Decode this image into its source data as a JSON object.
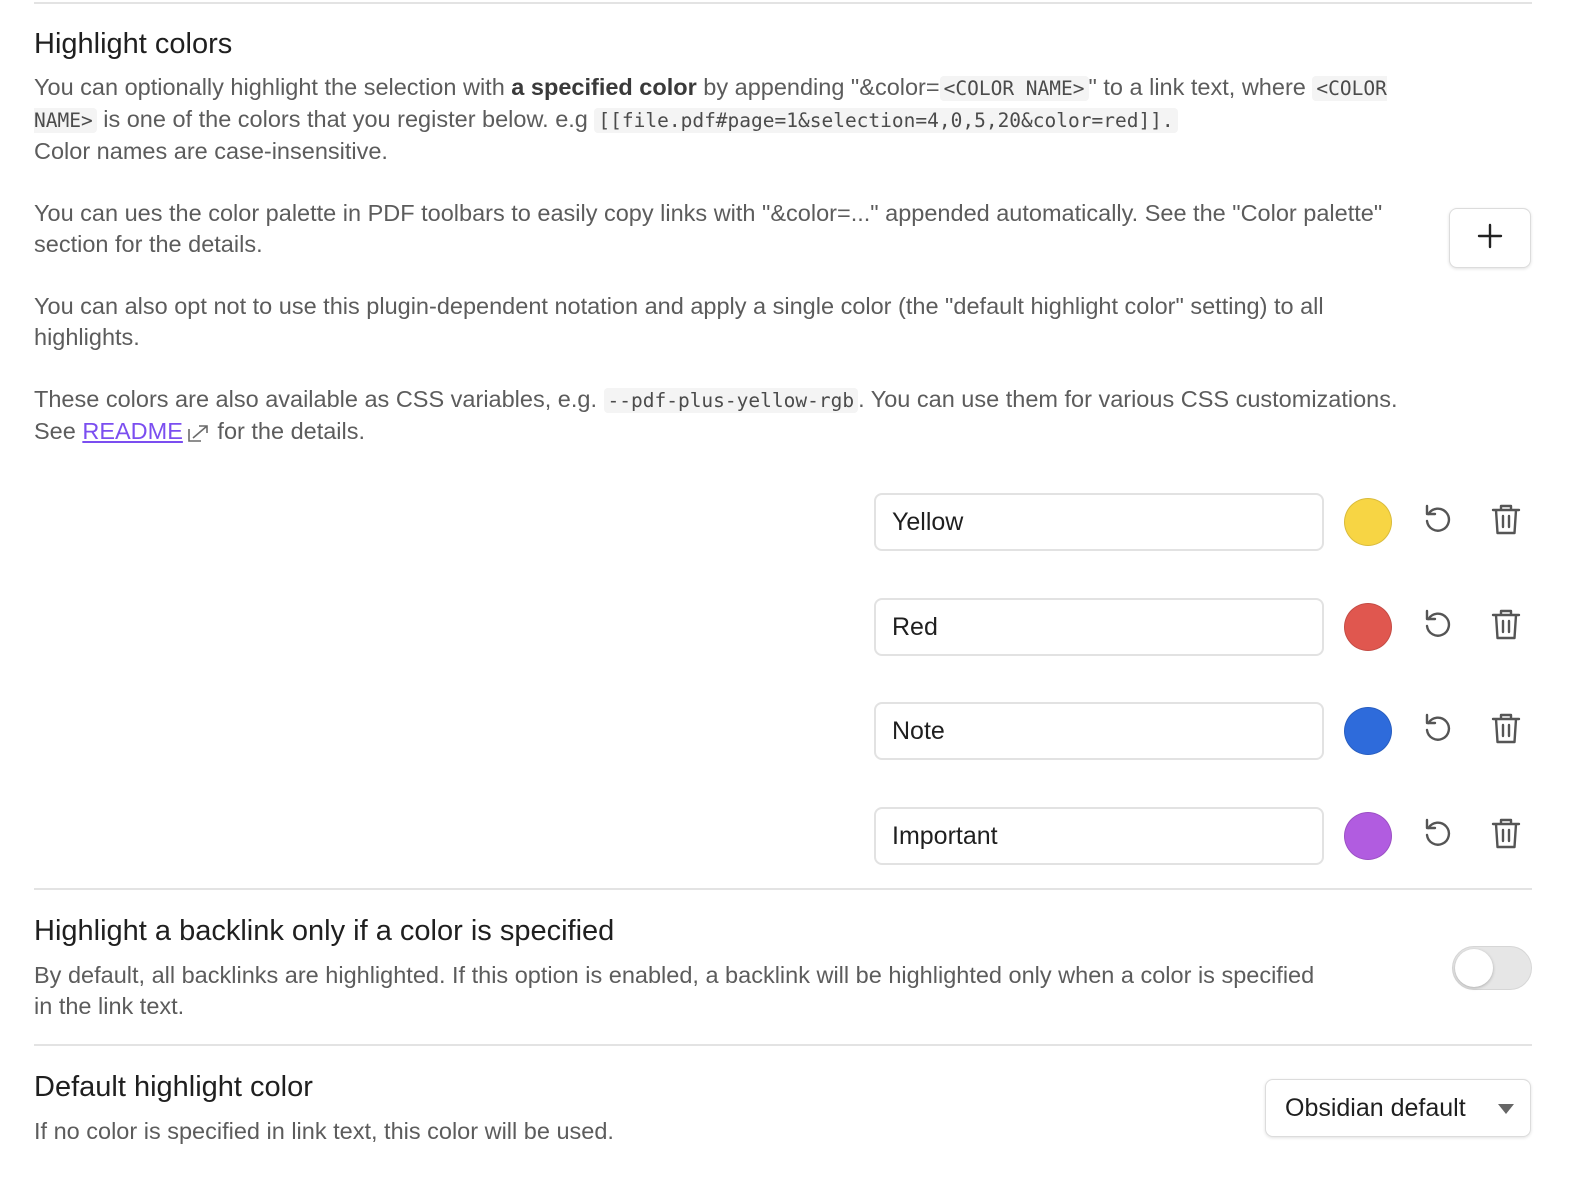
{
  "highlight_colors": {
    "title": "Highlight colors",
    "p1": {
      "t1": "You can optionally highlight the selection with ",
      "bold": "a specified color",
      "t2": " by appending \"&color=",
      "code1": "<COLOR NAME>",
      "t3": "\" to a link text, where ",
      "code2": "<COLOR NAME>",
      "t4": " is one of the colors that you register below. e.g ",
      "code3": "[[file.pdf#page=1&selection=4,0,5,20&color=red]].",
      "t5": " Color names are case-insensitive."
    },
    "p2": "You can ues the color palette in PDF toolbars to easily copy links with \"&color=...\" appended automatically. See the \"Color palette\" section for the details.",
    "p3": "You can also opt not to use this plugin-dependent notation and apply a single color (the \"default highlight color\" setting) to all highlights.",
    "p4": {
      "t1": "These colors are also available as CSS variables, e.g. ",
      "code": "--pdf-plus-yellow-rgb",
      "t2": ". You can use them for various CSS customizations. See ",
      "link": "README",
      "t3": " for the details."
    },
    "add_button_icon": "plus-icon",
    "colors": [
      {
        "name": "Yellow",
        "color": "#f7d544"
      },
      {
        "name": "Red",
        "color": "#e0574f"
      },
      {
        "name": "Note",
        "color": "#2e6bdb"
      },
      {
        "name": "Important",
        "color": "#b15ce0"
      }
    ],
    "row_icons": [
      "reset-icon",
      "trash-icon"
    ]
  },
  "backlink_setting": {
    "title": "Highlight a backlink only if a color is specified",
    "desc": "By default, all backlinks are highlighted. If this option is enabled, a backlink will be highlighted only when a color is specified in the link text.",
    "enabled": false
  },
  "default_color_setting": {
    "title": "Default highlight color",
    "desc": "If no color is specified in link text, this color will be used.",
    "selected": "Obsidian default"
  }
}
